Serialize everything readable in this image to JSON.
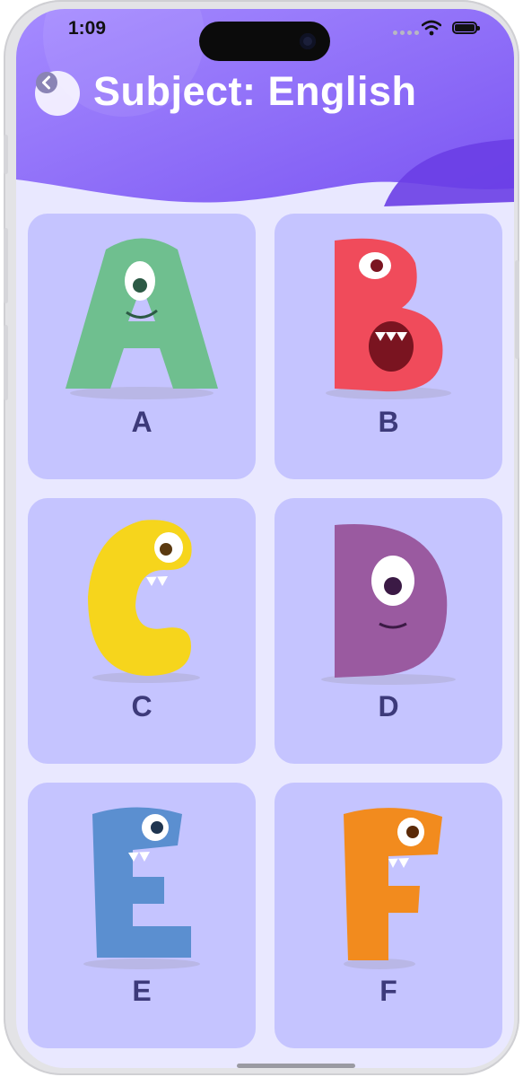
{
  "status": {
    "time": "1:09"
  },
  "header": {
    "title": "Subject: English",
    "back_label": "Back"
  },
  "letters": [
    {
      "letter": "A",
      "color": "#6fbf8f"
    },
    {
      "letter": "B",
      "color": "#f04b5b"
    },
    {
      "letter": "C",
      "color": "#f6d51c"
    },
    {
      "letter": "D",
      "color": "#9a5aa0"
    },
    {
      "letter": "E",
      "color": "#5b8fd0"
    },
    {
      "letter": "F",
      "color": "#f28b1e"
    }
  ],
  "colors": {
    "header_top": "#9b7bff",
    "header_accent": "#6a3ee6",
    "card_bg": "#c5c4ff",
    "screen_bg": "#e9e8ff",
    "label": "#3d3a7a"
  }
}
